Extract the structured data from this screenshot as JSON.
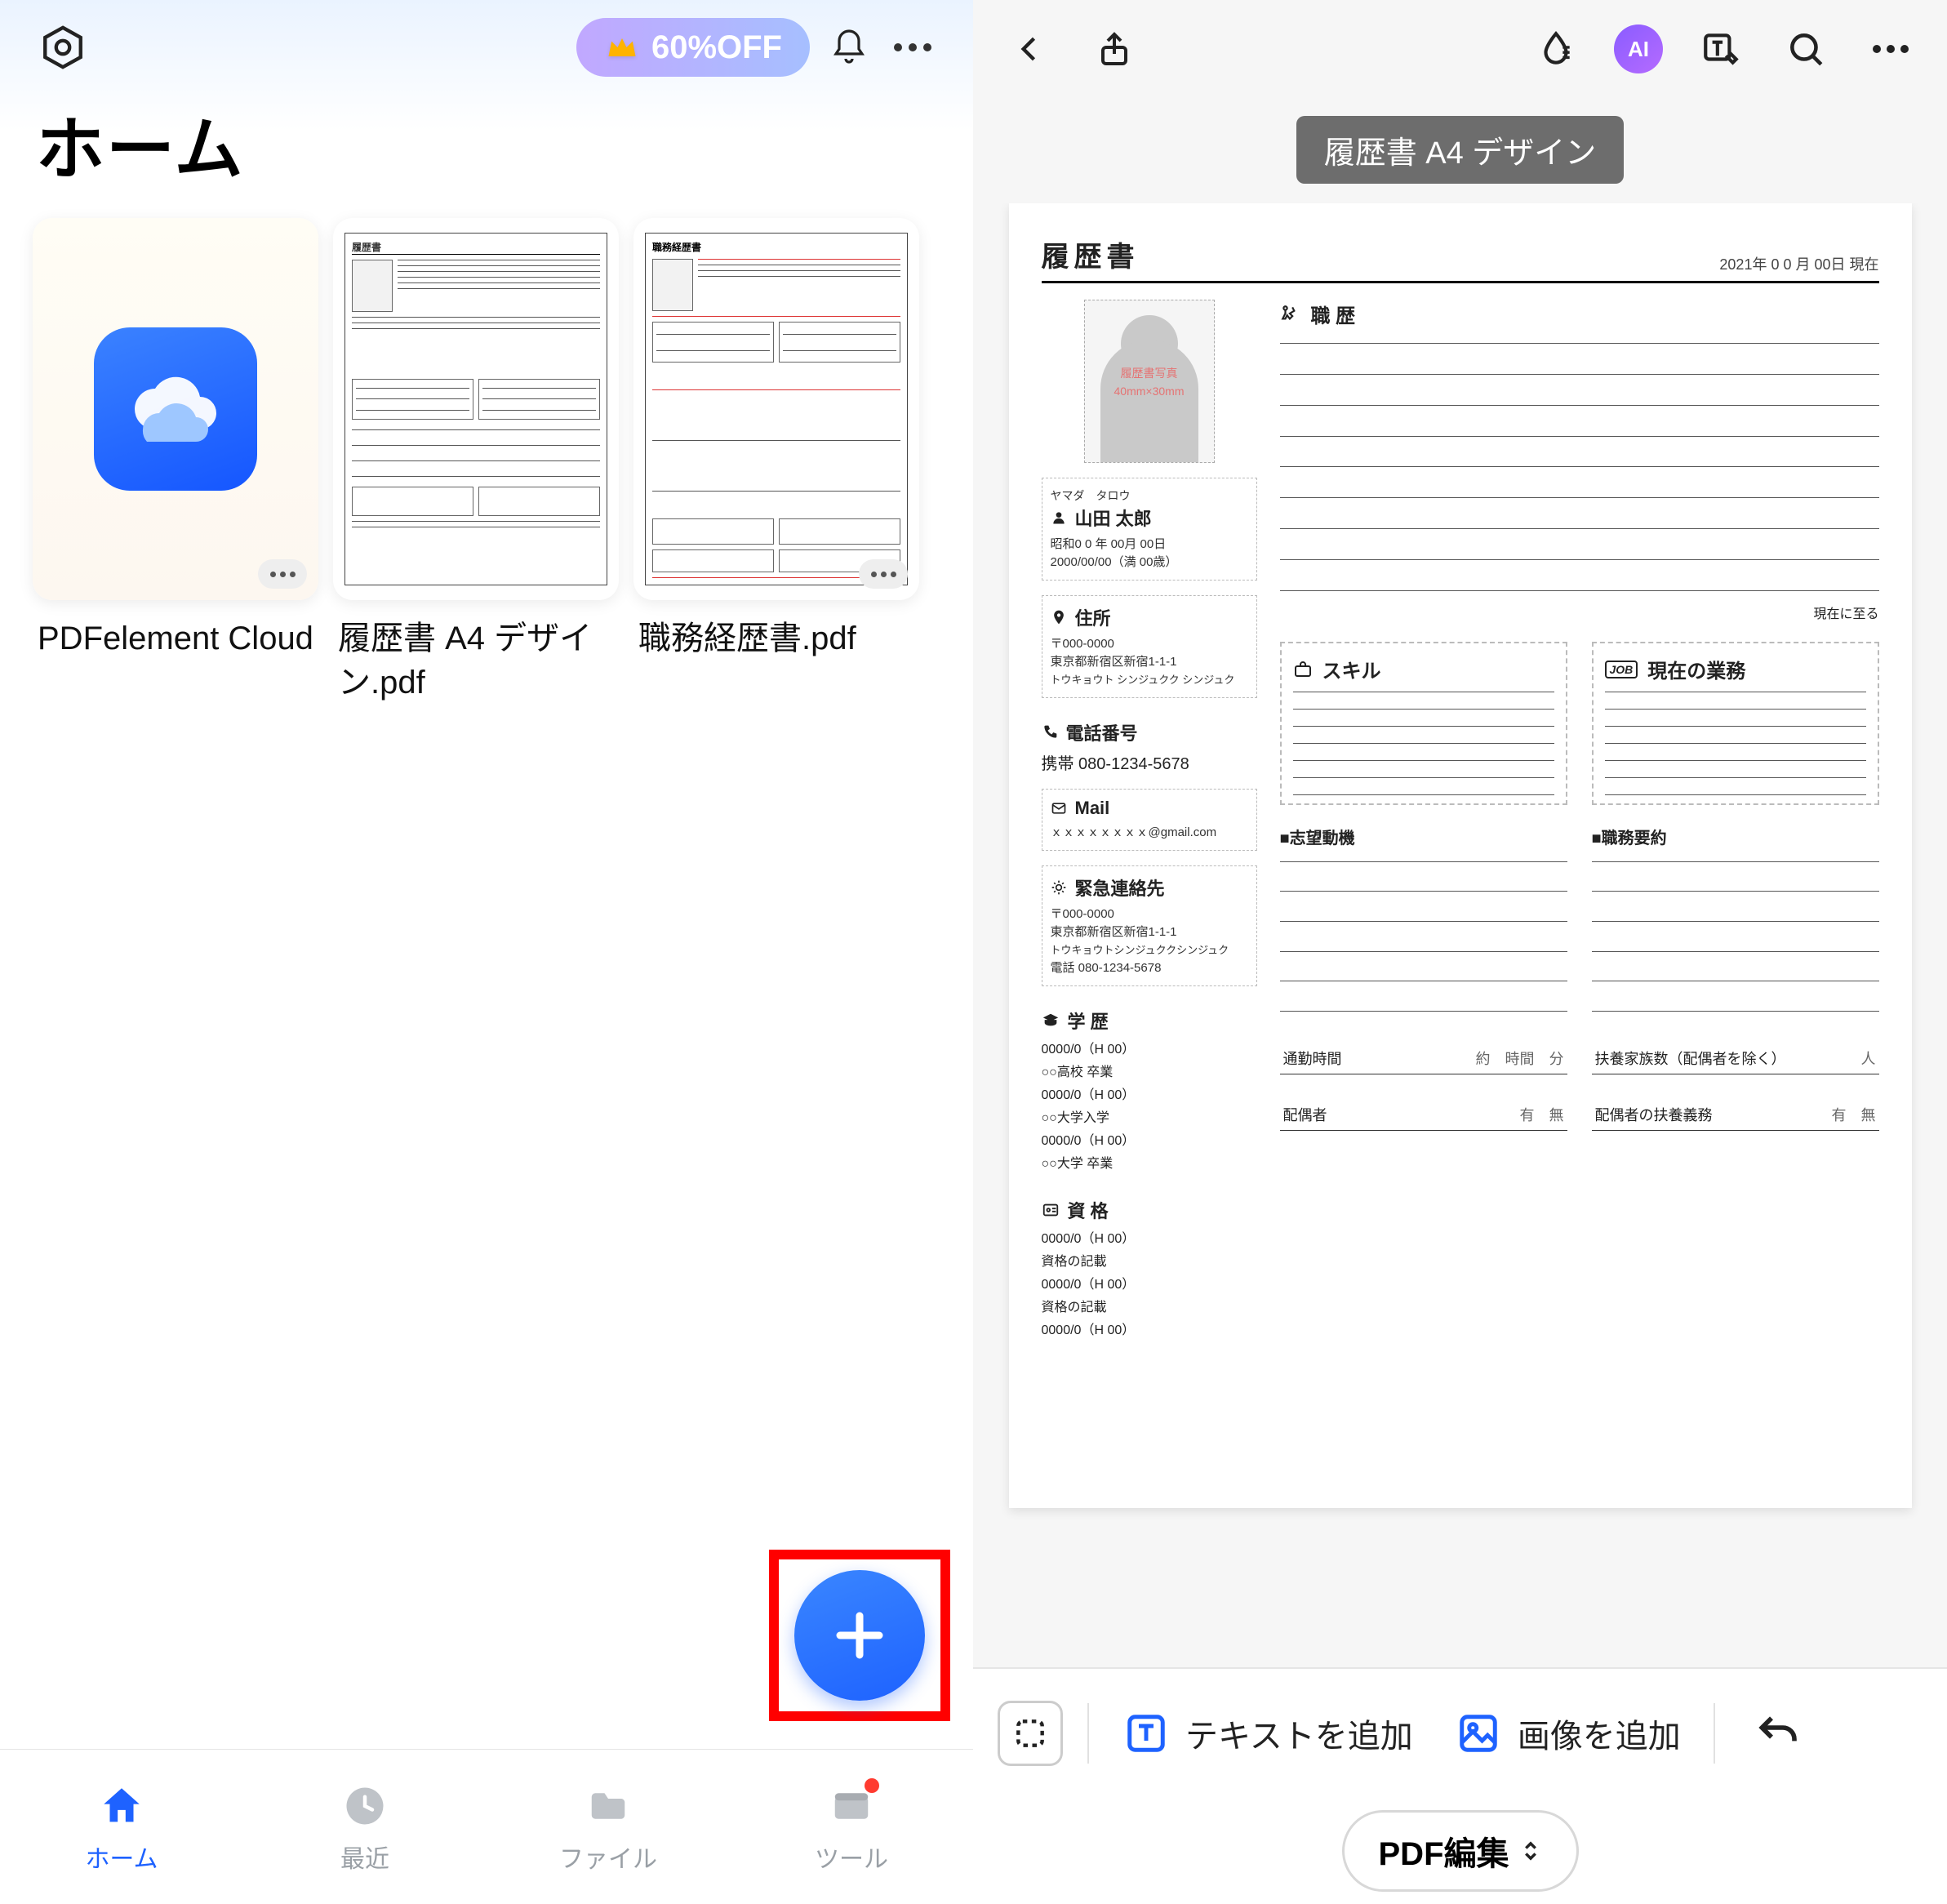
{
  "left": {
    "promo": "60%OFF",
    "title": "ホーム",
    "files": [
      {
        "name": "PDFelement Cloud"
      },
      {
        "name": "履歴書 A4 デザイン.pdf"
      },
      {
        "name": "職務経歴書.pdf"
      }
    ],
    "tabs": [
      {
        "label": "ホーム",
        "active": true
      },
      {
        "label": "最近",
        "active": false
      },
      {
        "label": "ファイル",
        "active": false
      },
      {
        "label": "ツール",
        "active": false,
        "badge": true
      }
    ]
  },
  "right": {
    "ai_label": "AI",
    "doc_title_pill": "履歴書 A4 デザイン",
    "page": {
      "title": "履歴書",
      "date": "2021年 0 0 月 00日 現在",
      "photo_label1": "履歴書写真",
      "photo_label2": "40mm×30mm",
      "furigana": "ヤマダ　タロウ",
      "name": "山田 太郎",
      "era": "昭和0 0 年  00月 00日",
      "birth": "2000/00/00（満 00歳）",
      "addr_h": "住所",
      "addr_zip": "〒000-0000",
      "addr1": "東京都新宿区新宿1-1-1",
      "addr2": "トウキョウト シンジュクク シンジュク",
      "tel_h": "電話番号",
      "tel": "携帯 080-1234-5678",
      "mail_h": "Mail",
      "mail": "ｘｘｘｘｘｘｘｘ@gmail.com",
      "em_h": "緊急連絡先",
      "em_zip": "〒000-0000",
      "em1": "東京都新宿区新宿1-1-1",
      "em2": "トウキョウトシンジュククシンジュク",
      "em_tel": "電話 080-1234-5678",
      "edu_h": "学 歴",
      "edu": [
        "0000/0（H 00）",
        "○○高校 卒業",
        "0000/0（H 00）",
        "○○大学入学",
        "0000/0（H 00）",
        "○○大学 卒業"
      ],
      "lic_h": "資 格",
      "lic": [
        "0000/0（H 00）",
        "資格の記載",
        "0000/0（H 00）",
        "資格の記載",
        "0000/0（H 00）"
      ],
      "work_h": "職 歴",
      "work_note": "現在に至る",
      "skill_h": "スキル",
      "job_h": "現在の業務",
      "job_tag": "JOB",
      "motive_h": "■志望動機",
      "summary_h": "■職務要約",
      "commute_l": "通勤時間",
      "commute_u1": "約",
      "commute_u2": "時間",
      "commute_u3": "分",
      "family_l": "扶養家族数（配偶者を除く）",
      "family_u": "人",
      "spouse_l": "配偶者",
      "spouse_u": "有　無",
      "support_l": "配偶者の扶養義務",
      "support_u": "有　無"
    },
    "toolbar": {
      "add_text": "テキストを追加",
      "add_image": "画像を追加"
    },
    "mode_label": "PDF編集"
  }
}
